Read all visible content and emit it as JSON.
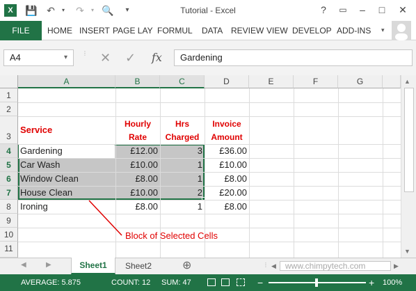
{
  "title": "Tutorial - Excel",
  "window_controls": {
    "help": "?",
    "restore": "▭",
    "minimize": "–",
    "maximize": "□",
    "close": "✕"
  },
  "ribbon": {
    "file": "FILE",
    "tabs": [
      "HOME",
      "INSERT",
      "PAGE LAY",
      "FORMUL",
      "DATA",
      "REVIEW",
      "VIEW",
      "DEVELOP",
      "ADD-INS"
    ]
  },
  "namebox": "A4",
  "formula": "Gardening",
  "fx": "fx",
  "columns": [
    "A",
    "B",
    "C",
    "D",
    "E",
    "F",
    "G"
  ],
  "rows": [
    "1",
    "2",
    "3",
    "4",
    "5",
    "6",
    "7",
    "8",
    "9",
    "10",
    "11"
  ],
  "headers": {
    "service": "Service",
    "hourly_rate": [
      "Hourly",
      "Rate"
    ],
    "hrs_charged": [
      "Hrs",
      "Charged"
    ],
    "invoice_amount": [
      "Invoice",
      "Amount"
    ]
  },
  "table": [
    {
      "service": "Gardening",
      "rate": "£12.00",
      "hrs": "3",
      "amount": "£36.00"
    },
    {
      "service": "Car Wash",
      "rate": "£10.00",
      "hrs": "1",
      "amount": "£10.00"
    },
    {
      "service": "Window Clean",
      "rate": "£8.00",
      "hrs": "1",
      "amount": "£8.00"
    },
    {
      "service": "House Clean",
      "rate": "£10.00",
      "hrs": "2",
      "amount": "£20.00"
    },
    {
      "service": "Ironing",
      "rate": "£8.00",
      "hrs": "1",
      "amount": "£8.00"
    }
  ],
  "annotation": "Block of Selected Cells",
  "watermark": "www.chimpytech.com",
  "sheets": [
    "Sheet1",
    "Sheet2"
  ],
  "add_sheet": "⊕",
  "status": {
    "average": "AVERAGE: 5.875",
    "count": "COUNT: 12",
    "sum": "SUM: 47",
    "zoom": "100%"
  },
  "colors": {
    "excel_green": "#217346",
    "selection": "#c6c6c6",
    "annotation_red": "#e00000"
  }
}
